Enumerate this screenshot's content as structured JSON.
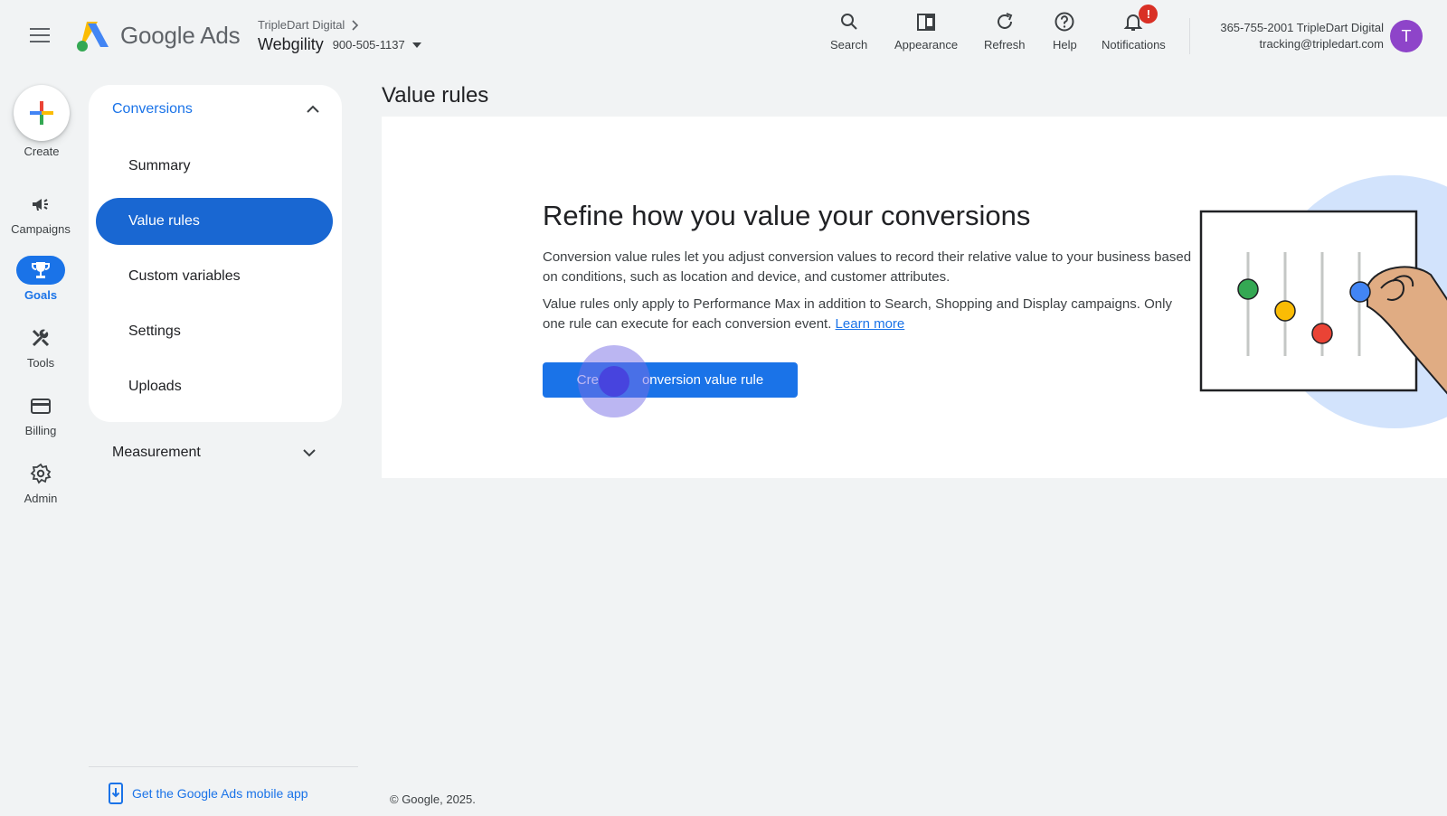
{
  "header": {
    "brand": "Google Ads",
    "account_parent": "TripleDart Digital",
    "account_name": "Webgility",
    "account_id": "900-505-1137",
    "tools": [
      {
        "label": "Search",
        "icon": "search-icon"
      },
      {
        "label": "Appearance",
        "icon": "appearance-icon"
      },
      {
        "label": "Refresh",
        "icon": "refresh-icon"
      },
      {
        "label": "Help",
        "icon": "help-icon"
      },
      {
        "label": "Notifications",
        "icon": "bell-icon",
        "badge": "!"
      }
    ],
    "user_line1": "365-755-2001 TripleDart Digital",
    "user_line2": "tracking@tripledart.com",
    "avatar_letter": "T"
  },
  "rail": {
    "create_label": "Create",
    "items": [
      {
        "label": "Campaigns",
        "icon": "megaphone-icon",
        "active": false
      },
      {
        "label": "Goals",
        "icon": "trophy-icon",
        "active": true
      },
      {
        "label": "Tools",
        "icon": "tools-icon",
        "active": false
      },
      {
        "label": "Billing",
        "icon": "credit-card-icon",
        "active": false
      },
      {
        "label": "Admin",
        "icon": "gear-icon",
        "active": false
      }
    ]
  },
  "sidenav": {
    "section": "Conversions",
    "items": [
      "Summary",
      "Value rules",
      "Custom variables",
      "Settings",
      "Uploads"
    ],
    "active": "Value rules",
    "collapsed_section": "Measurement",
    "mobile_link": "Get the Google Ads mobile app"
  },
  "main": {
    "page_title": "Value rules",
    "hero_title": "Refine how you value your conversions",
    "paragraph1": "Conversion value rules let you adjust conversion values to record their relative value to your business based on conditions, such as location and device, and customer attributes.",
    "paragraph2": "Value rules only apply to Performance Max in addition to Search, Shopping and Display campaigns. Only one rule can execute for each conversion event.",
    "learn_more": "Learn more",
    "cta_visible": "Cre",
    "cta_visible_rest": "onversion value rule"
  },
  "footer": {
    "copyright": "© Google, 2025."
  },
  "colors": {
    "primary": "#1a73e8",
    "background": "#f1f3f4",
    "badge": "#d93025",
    "avatar": "#8e44c9"
  }
}
